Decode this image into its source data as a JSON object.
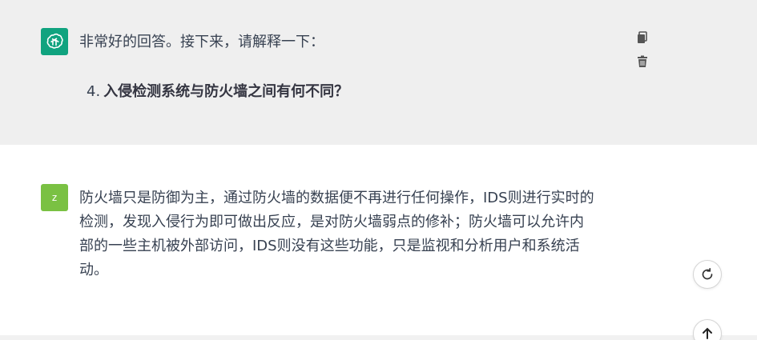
{
  "messages": [
    {
      "role": "assistant",
      "avatar_icon": "openai-logo-icon",
      "avatar_color": "#10a37f",
      "text": "非常好的回答。接下来，请解释一下：",
      "list": [
        {
          "number": "4.",
          "text": "入侵检测系统与防火墙之间有何不同？"
        }
      ],
      "actions": [
        {
          "icon": "copy-icon"
        },
        {
          "icon": "trash-icon"
        }
      ]
    },
    {
      "role": "user",
      "avatar_letter": "z",
      "avatar_color": "#7ac143",
      "lines": [
        "防火墙只是防御为主，通过防火墙的数据便不再进行任何操作，IDS则进行实时的",
        "检测，发现入侵行为即可做出反应，是对防火墙弱点的修补；防火墙可以允许内",
        "部的一些主机被外部访问，IDS则没有这些功能，只是监视和分析用户和系统活",
        "动。"
      ]
    }
  ],
  "controls": {
    "regenerate_icon": "regenerate-icon",
    "scroll_up_icon": "arrow-up-icon"
  }
}
